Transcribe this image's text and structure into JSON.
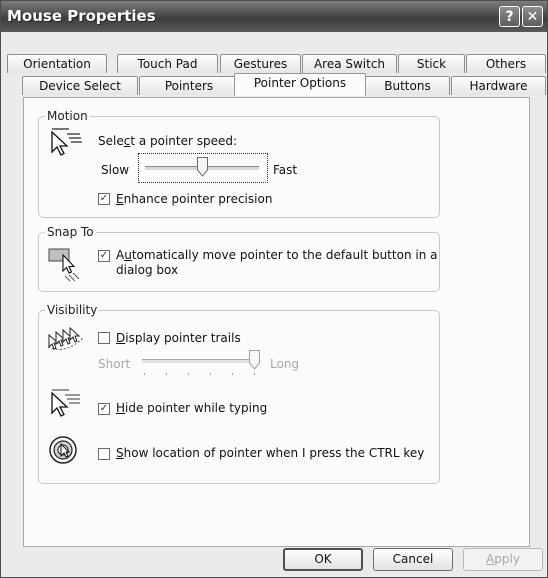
{
  "window": {
    "title": "Mouse Properties",
    "help_label": "?",
    "close_label": "✕"
  },
  "tabs": {
    "row1": [
      "Orientation",
      "Touch Pad",
      "Gestures",
      "Area Switch",
      "Stick",
      "Others"
    ],
    "row2": [
      "Device Select",
      "Pointers",
      "Pointer Options",
      "Buttons",
      "Hardware"
    ],
    "active": "Pointer Options"
  },
  "motion": {
    "group_label": "Motion",
    "speed_label_pre": "Sele",
    "speed_label_key": "c",
    "speed_label_post": "t a pointer speed:",
    "slow_label": "Slow",
    "fast_label": "Fast",
    "speed_value": 0.5,
    "enhance_key": "E",
    "enhance_rest": "nhance pointer precision",
    "enhance_checked": true,
    "pointer_icon": "pointer-speed-icon"
  },
  "snap_to": {
    "group_label": "Snap To",
    "auto_pre": "A",
    "auto_key": "u",
    "auto_line1_rest": "tomatically move pointer to the default button in a",
    "auto_line2": "dialog box",
    "checked": true,
    "icon": "snap-to-icon"
  },
  "visibility": {
    "group_label": "Visibility",
    "trails_key": "D",
    "trails_rest": "isplay pointer trails",
    "trails_checked": false,
    "short_label": "Short",
    "long_label": "Long",
    "trail_length_value": 1.0,
    "hide_key": "H",
    "hide_rest": "ide pointer while typing",
    "hide_checked": true,
    "show_key": "S",
    "show_rest": "how location of pointer when I press the CTRL key",
    "show_checked": false,
    "trails_icon": "pointer-trails-icon",
    "hide_icon": "hide-pointer-icon",
    "show_icon": "locate-pointer-icon"
  },
  "buttons": {
    "ok": "OK",
    "cancel": "Cancel",
    "apply_key": "A",
    "apply_rest": "pply"
  },
  "check_mark": "✓"
}
